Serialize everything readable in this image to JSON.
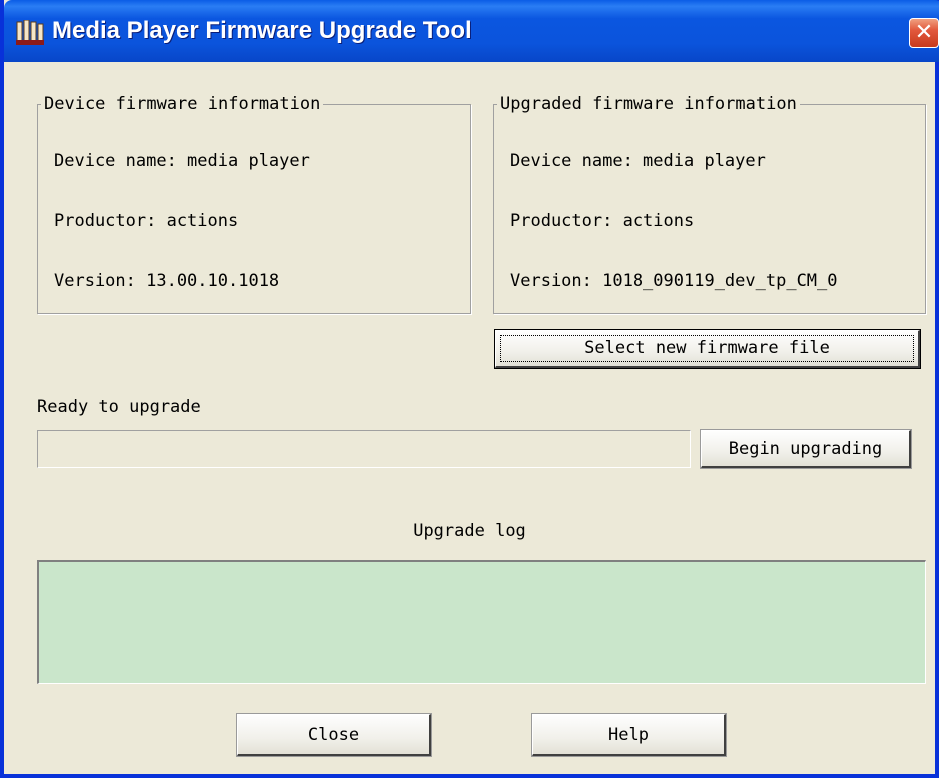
{
  "window": {
    "title": "Media Player Firmware Upgrade Tool",
    "close_glyph": "✕",
    "accent": "#0b54dc"
  },
  "device_info": {
    "legend": "Device firmware information",
    "device_name": "Device name: media player",
    "productor": "Productor: actions",
    "version": "Version: 13.00.10.1018"
  },
  "upgraded_info": {
    "legend": "Upgraded firmware information",
    "device_name": "Device name: media player",
    "productor": "Productor: actions",
    "version": "Version: 1018_090119_dev_tp_CM_0"
  },
  "buttons": {
    "select_file": "Select new firmware file",
    "begin": "Begin upgrading",
    "close": "Close",
    "help": "Help"
  },
  "status": {
    "text": "Ready to upgrade",
    "progress": 0
  },
  "log": {
    "title": "Upgrade log",
    "background": "#cae6cb",
    "content": ""
  }
}
